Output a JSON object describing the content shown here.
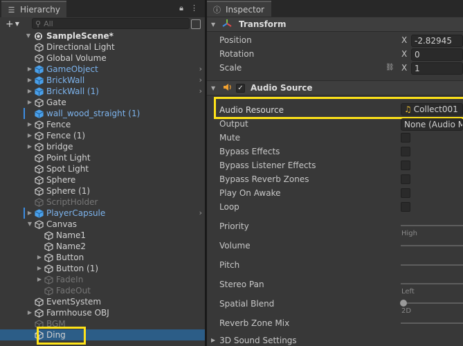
{
  "hierarchy": {
    "tab_title": "Hierarchy",
    "tab_icon": "list-icon",
    "search_placeholder": "All",
    "add_label": "+",
    "scene_name": "SampleScene*",
    "items": [
      {
        "label": "Directional Light"
      },
      {
        "label": "Global Volume"
      },
      {
        "label": "GameObject"
      },
      {
        "label": "BrickWall"
      },
      {
        "label": "BrickWall (1)"
      },
      {
        "label": "Gate"
      },
      {
        "label": "wall_wood_straight (1)"
      },
      {
        "label": "Fence"
      },
      {
        "label": "Fence (1)"
      },
      {
        "label": "bridge"
      },
      {
        "label": "Point Light"
      },
      {
        "label": "Spot Light"
      },
      {
        "label": "Sphere"
      },
      {
        "label": "Sphere (1)"
      },
      {
        "label": "ScriptHolder"
      },
      {
        "label": "PlayerCapsule"
      },
      {
        "label": "Canvas"
      },
      {
        "label": "Name1"
      },
      {
        "label": "Name2"
      },
      {
        "label": "Button"
      },
      {
        "label": "Button (1)"
      },
      {
        "label": "FadeIn"
      },
      {
        "label": "FadeOut"
      },
      {
        "label": "EventSystem"
      },
      {
        "label": "Farmhouse OBJ"
      },
      {
        "label": "BGM"
      },
      {
        "label": "Ding"
      }
    ]
  },
  "inspector": {
    "tab_title": "Inspector",
    "transform": {
      "title": "Transform",
      "position_label": "Position",
      "rotation_label": "Rotation",
      "scale_label": "Scale",
      "axis_x": "X",
      "position_x": "-2.82945",
      "rotation_x": "0",
      "scale_x": "1"
    },
    "audio_source": {
      "title": "Audio Source",
      "audio_resource_label": "Audio Resource",
      "audio_resource_value": "Collect001",
      "output_label": "Output",
      "output_value": "None (Audio Mi",
      "mute_label": "Mute",
      "bypass_effects_label": "Bypass Effects",
      "bypass_listener_label": "Bypass Listener Effects",
      "bypass_reverb_label": "Bypass Reverb Zones",
      "play_on_awake_label": "Play On Awake",
      "loop_label": "Loop",
      "priority_label": "Priority",
      "priority_hint": "High",
      "volume_label": "Volume",
      "pitch_label": "Pitch",
      "stereo_pan_label": "Stereo Pan",
      "stereo_pan_hint": "Left",
      "spatial_blend_label": "Spatial Blend",
      "spatial_blend_hint": "2D",
      "reverb_zone_mix_label": "Reverb Zone Mix",
      "sound_settings_label": "3D Sound Settings"
    }
  },
  "colors": {
    "highlight": "#ffe319",
    "prefab_text": "#7db4ee",
    "selection": "#2c5d87"
  }
}
